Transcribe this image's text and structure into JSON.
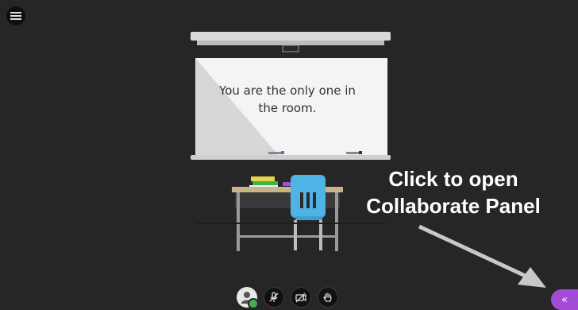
{
  "room": {
    "message": "You are the only one in the room."
  },
  "annotation": {
    "line1": "Click to open",
    "line2": "Collaborate Panel"
  },
  "controls": {
    "icons": [
      "avatar-icon",
      "microphone-muted-icon",
      "camera-off-icon",
      "raise-hand-icon"
    ]
  },
  "panel_toggle": {
    "label": "«"
  },
  "colors": {
    "background": "#262626",
    "accent_purple": "#a34bd6",
    "status_green": "#3cb54a",
    "chair_blue": "#4fb3e6"
  }
}
